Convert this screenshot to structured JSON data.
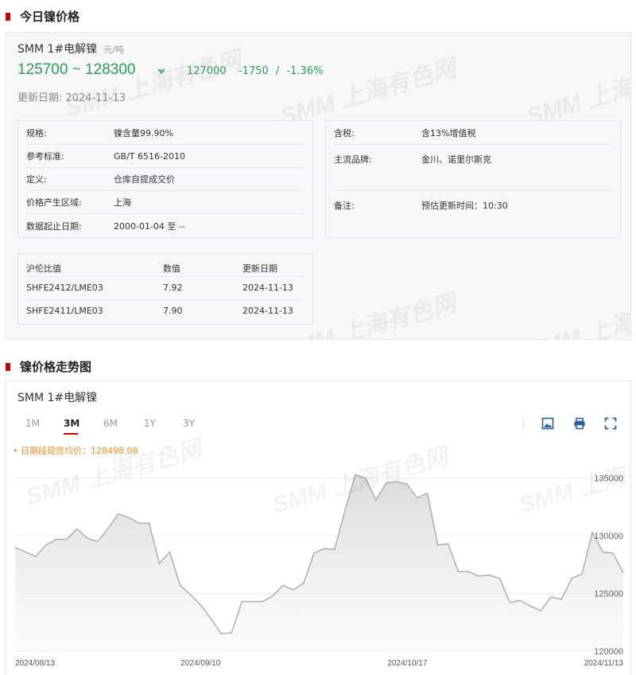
{
  "section1": {
    "title": "今日镍价格"
  },
  "product": {
    "name": "SMM 1#电解镍",
    "unit": "元/吨",
    "price_range": "125700 ~ 128300",
    "average": "127000",
    "change": "-1750",
    "change_sep": "/",
    "change_pct": "-1.36%",
    "update_label": "更新日期:",
    "update_date": "2024-11-13"
  },
  "specs_left": [
    {
      "key": "规格:",
      "value": "镍含量99.90%"
    },
    {
      "key": "参考标准:",
      "value": "GB/T 6516-2010"
    },
    {
      "key": "定义:",
      "value": "仓库自提成交价"
    },
    {
      "key": "价格产生区域:",
      "value": "上海"
    },
    {
      "key": "数据起止日期:",
      "value": "2000-01-04 至 --"
    }
  ],
  "specs_right": [
    {
      "key": "含税:",
      "value": "含13%增值税"
    },
    {
      "key": "主流品牌:",
      "value": "金川、诺里尔斯克"
    },
    {
      "key": "备注:",
      "value": "预估更新时间：10:30"
    }
  ],
  "ratio": {
    "headers": [
      "沪伦比值",
      "数值",
      "更新日期"
    ],
    "rows": [
      [
        "SHFE2412/LME03",
        "7.92",
        "2024-11-13"
      ],
      [
        "SHFE2411/LME03",
        "7.90",
        "2024-11-13"
      ]
    ]
  },
  "watermark": "SMM 上海有色网",
  "section2": {
    "title": "镍价格走势图"
  },
  "trend": {
    "title": "SMM 1#电解镍",
    "tabs": [
      "1M",
      "3M",
      "6M",
      "1Y",
      "3Y"
    ],
    "active_tab": "3M",
    "tools": [
      "save-image-icon",
      "print-icon",
      "fullscreen-icon"
    ],
    "avg_note": "• 日期段现货均价：128498.08"
  },
  "colors": {
    "brand_red": "#cc0000",
    "down_green": "#2e9b57",
    "note_orange": "#f08c2e",
    "line": "#aaaaaa"
  },
  "chart_data": {
    "type": "area",
    "x_ticks": [
      "2024/08/13",
      "2024/09/10",
      "2024/10/17",
      "2024/11/13"
    ],
    "y_ticks": [
      120000,
      125000,
      130000,
      135000
    ],
    "ylim": [
      120000,
      136500
    ],
    "grid": true,
    "series": [
      {
        "values": [
          129000,
          128600,
          128200,
          129200,
          129700,
          129700,
          130600,
          129800,
          129500,
          130600,
          131900,
          131600,
          131100,
          131100,
          127600,
          128600,
          125700,
          124900,
          124000,
          122800,
          121500,
          121600,
          124300,
          124300,
          124300,
          124800,
          125700,
          125300,
          125900,
          128500,
          128900,
          128800,
          132200,
          135300,
          135000,
          133100,
          134600,
          134700,
          134500,
          133300,
          133700,
          129200,
          129300,
          126900,
          126900,
          126500,
          126600,
          126300,
          124200,
          124400,
          123900,
          123500,
          124700,
          124500,
          126300,
          126700,
          130300,
          128600,
          128500,
          126800
        ]
      }
    ]
  }
}
